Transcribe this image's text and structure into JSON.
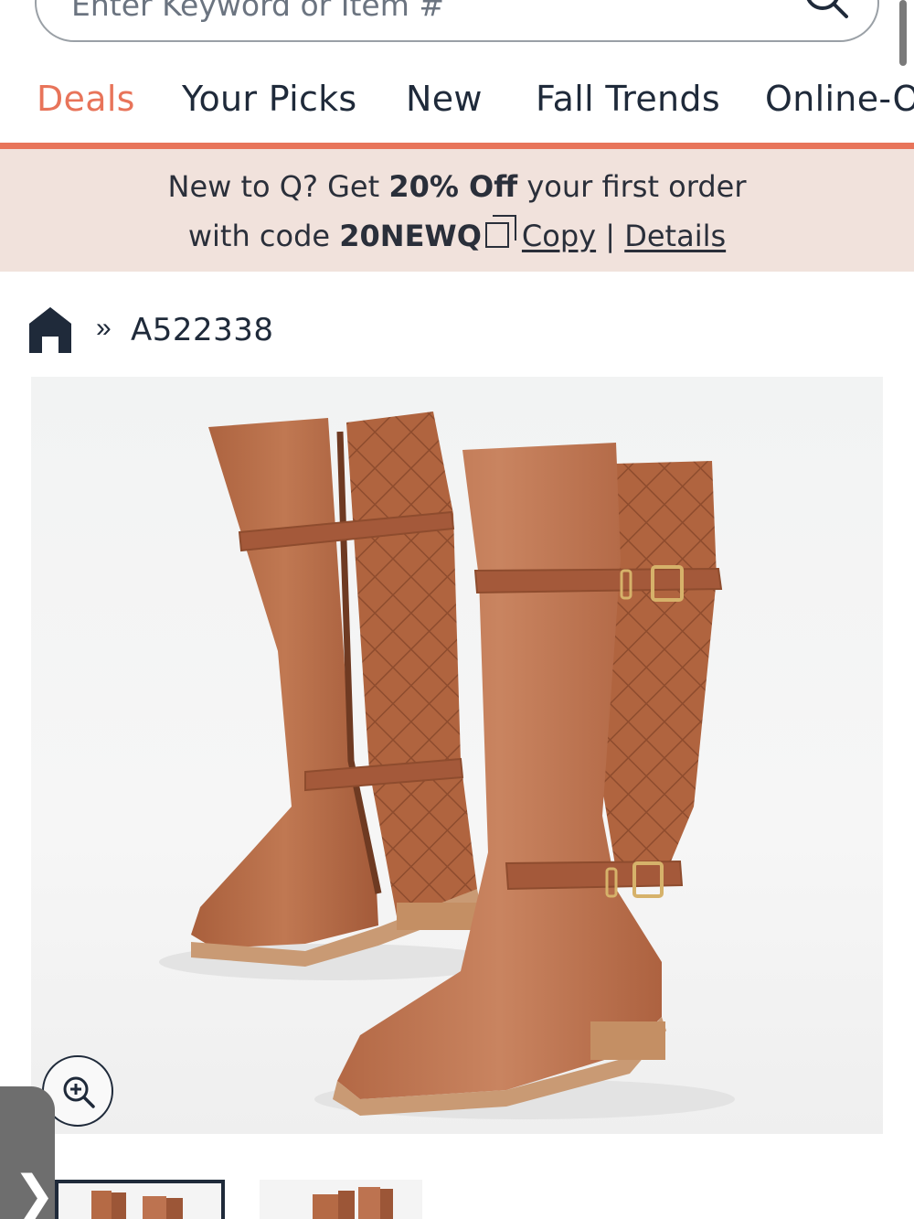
{
  "search": {
    "placeholder": "Enter Keyword or Item #"
  },
  "nav": {
    "categories": [
      {
        "label": "Deals",
        "active": true
      },
      {
        "label": "Your Picks",
        "active": false
      },
      {
        "label": "New",
        "active": false
      },
      {
        "label": "Fall Trends",
        "active": false
      },
      {
        "label": "Online-Only",
        "active": false
      }
    ]
  },
  "promo": {
    "line1_prefix": "New to Q? Get ",
    "line1_bold": "20% Off",
    "line1_suffix": " your first order",
    "line2_prefix": "with code ",
    "code": "20NEWQ",
    "copy_label": "Copy",
    "separator": "|",
    "details_label": "Details"
  },
  "breadcrumb": {
    "separator": "»",
    "item_number": "A522338"
  },
  "colors": {
    "accent": "#e8745a",
    "promo_bg": "#f1e2dc",
    "text": "#1f2a3a",
    "boot_leather": "#b56a45"
  },
  "icons": {
    "search": "search-icon",
    "home": "home-icon",
    "zoom": "zoom-in-icon",
    "copy": "copy-icon",
    "side_tab": "chevron-right-icon"
  },
  "side_tab": {
    "chevron": "❯"
  }
}
